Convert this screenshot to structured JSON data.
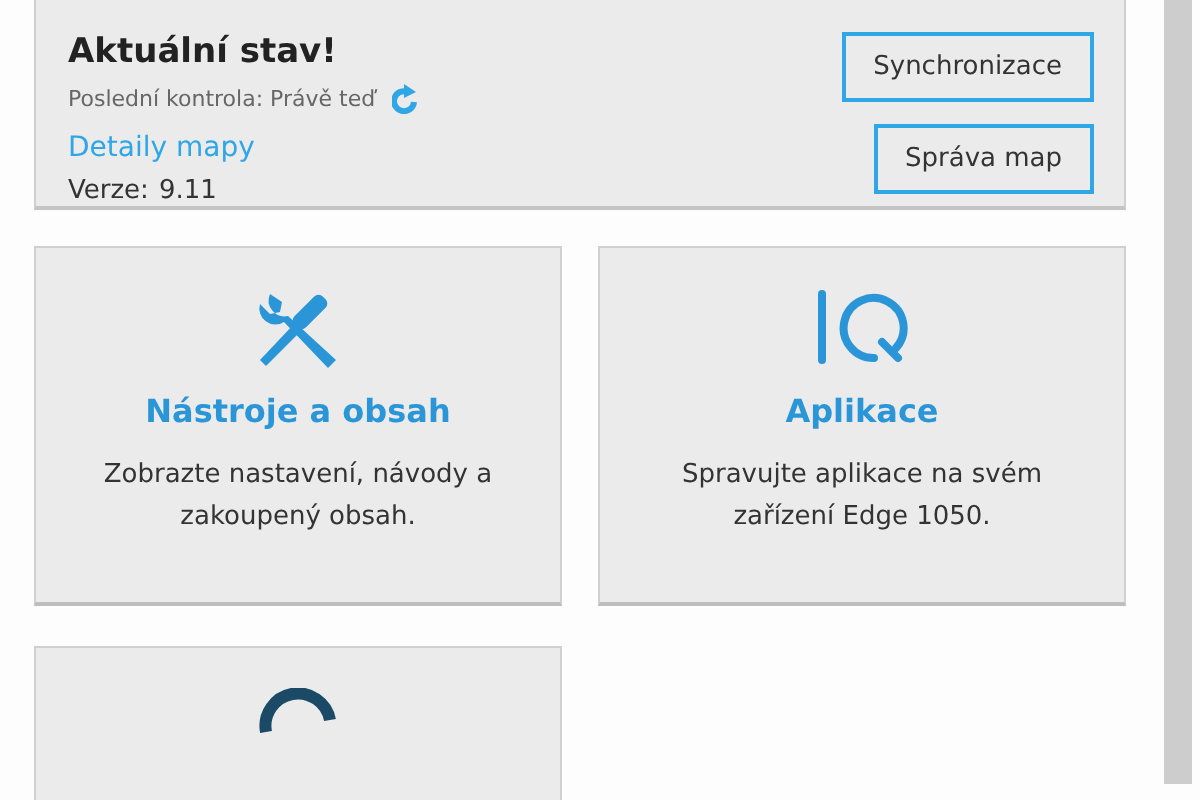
{
  "status": {
    "title": "Aktuální stav!",
    "last_check": "Poslední kontrola: Právě teď",
    "details_link": "Detaily mapy",
    "version_label": "Verze:",
    "version": "9.11",
    "buttons": [
      "Synchronizace",
      "Správa map"
    ]
  },
  "cards": [
    {
      "kind": "tools",
      "title": "Nástroje a obsah",
      "description": "Zobrazte nastavení, návody a zakoupený obsah."
    },
    {
      "kind": "iq",
      "title": "Aplikace",
      "description": "Spravujte aplikace na svém zařízení Edge 1050."
    },
    {
      "kind": "gauge"
    }
  ]
}
